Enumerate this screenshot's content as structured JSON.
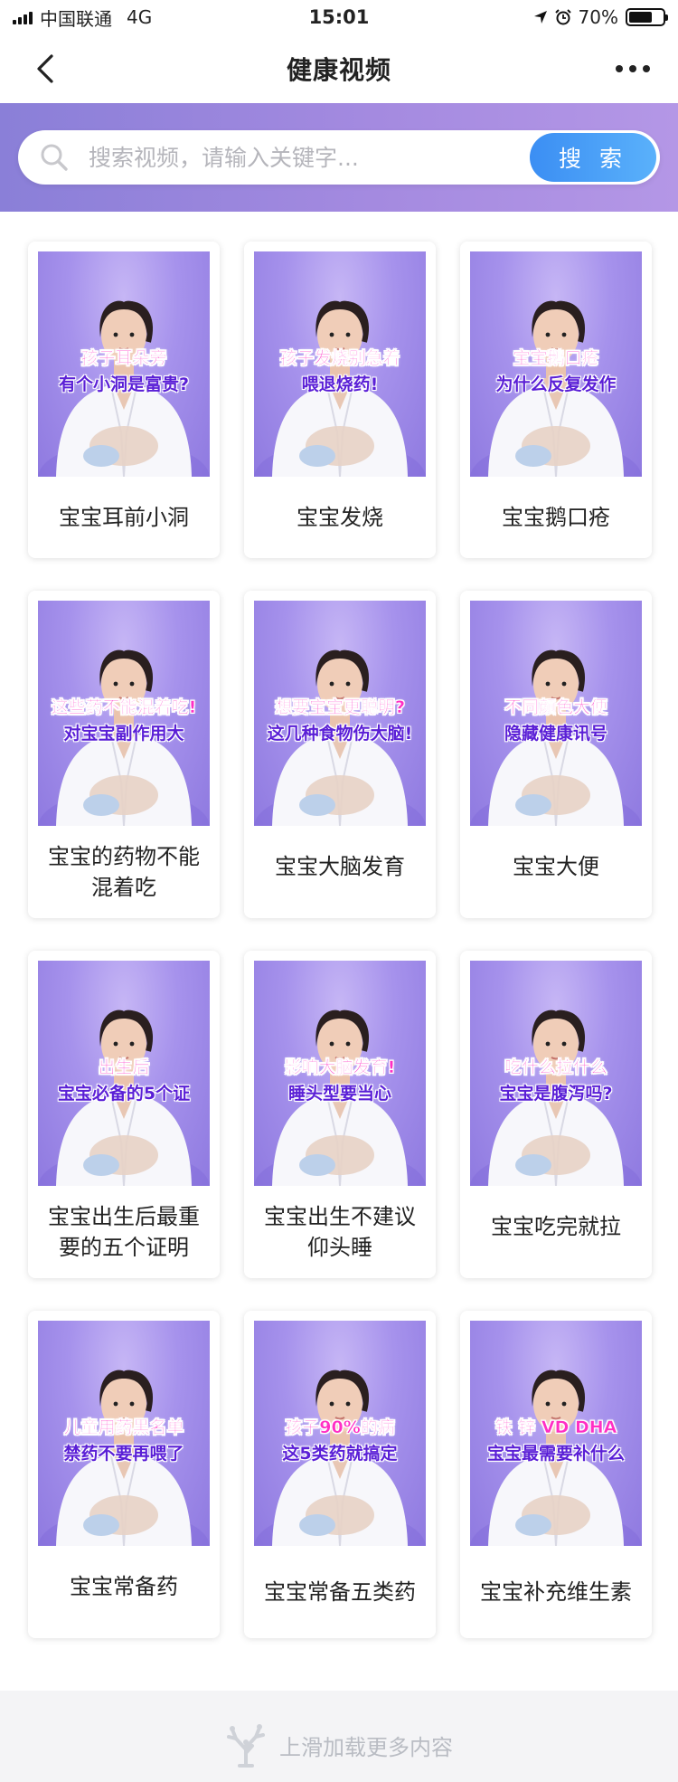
{
  "status_bar": {
    "carrier": "中国联通",
    "network": "4G",
    "time": "15:01",
    "battery": "70%",
    "battery_level": 0.7
  },
  "nav": {
    "title": "健康视频"
  },
  "search": {
    "placeholder": "搜索视频，请输入关键字...",
    "button_label": "搜 索"
  },
  "videos": [
    {
      "title": "宝宝耳前小洞",
      "caption": [
        "孩子耳朵旁",
        "有个小洞是富贵?"
      ]
    },
    {
      "title": "宝宝发烧",
      "caption": [
        "孩子发烧别急着",
        "喂退烧药!"
      ]
    },
    {
      "title": "宝宝鹅口疮",
      "caption": [
        "宝宝鹅口疮",
        "为什么反复发作"
      ]
    },
    {
      "title": "宝宝的药物不能混着吃",
      "caption": [
        "这些药不能混着吃!",
        "对宝宝副作用大"
      ]
    },
    {
      "title": "宝宝大脑发育",
      "caption": [
        "想要宝宝更聪明?",
        "这几种食物伤大脑!"
      ]
    },
    {
      "title": "宝宝大便",
      "caption": [
        "不同颜色大便",
        "隐藏健康讯号"
      ]
    },
    {
      "title": "宝宝出生后最重要的五个证明",
      "caption": [
        "出生后",
        "宝宝必备的5个证"
      ]
    },
    {
      "title": "宝宝出生不建议仰头睡",
      "caption": [
        "影响大脑发育!",
        "睡头型要当心"
      ]
    },
    {
      "title": "宝宝吃完就拉",
      "caption": [
        "吃什么拉什么",
        "宝宝是腹泻吗?"
      ]
    },
    {
      "title": "宝宝常备药",
      "caption": [
        "儿童用药黑名单",
        "禁药不要再喂了"
      ]
    },
    {
      "title": "宝宝常备五类药",
      "caption": [
        "孩子90%的病",
        "这5类药就搞定"
      ]
    },
    {
      "title": "宝宝补充维生素",
      "caption": [
        "铁 锌 VD DHA",
        "宝宝最需要补什么"
      ]
    }
  ],
  "footer": {
    "load_more": "上滑加载更多内容"
  },
  "colors": {
    "accent": "#4a9bf6",
    "band": "#a48ae0",
    "caption_pink": "#ff2fc4",
    "caption_purple": "#5a1fd6"
  }
}
